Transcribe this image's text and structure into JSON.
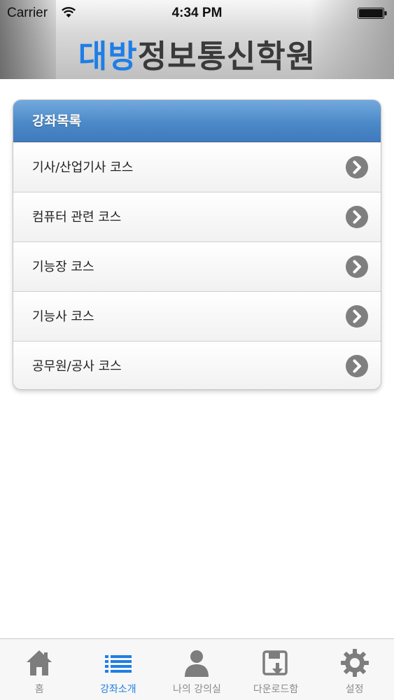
{
  "status_bar": {
    "carrier": "Carrier",
    "time": "4:34 PM"
  },
  "header": {
    "title_accent": "대방",
    "title_rest": "정보통신학원",
    "accent_color": "#1f7ee6"
  },
  "course_list": {
    "title": "강좌목록",
    "items": [
      {
        "label": "기사/산업기사 코스",
        "icon": "chevron-right-icon"
      },
      {
        "label": "컴퓨터 관련 코스",
        "icon": "chevron-right-icon"
      },
      {
        "label": "기능장 코스",
        "icon": "chevron-right-icon"
      },
      {
        "label": "기능사 코스",
        "icon": "chevron-right-icon"
      },
      {
        "label": "공무원/공사 코스",
        "icon": "chevron-right-icon"
      }
    ]
  },
  "tab_bar": {
    "active_tab": "강좌소개",
    "active_color": "#1f7ee6",
    "tabs": [
      {
        "label": "홈",
        "icon": "home-icon"
      },
      {
        "label": "강좌소개",
        "icon": "list-icon"
      },
      {
        "label": "나의 강의실",
        "icon": "person-icon"
      },
      {
        "label": "다운로드함",
        "icon": "download-icon"
      },
      {
        "label": "설정",
        "icon": "gear-icon"
      }
    ]
  }
}
